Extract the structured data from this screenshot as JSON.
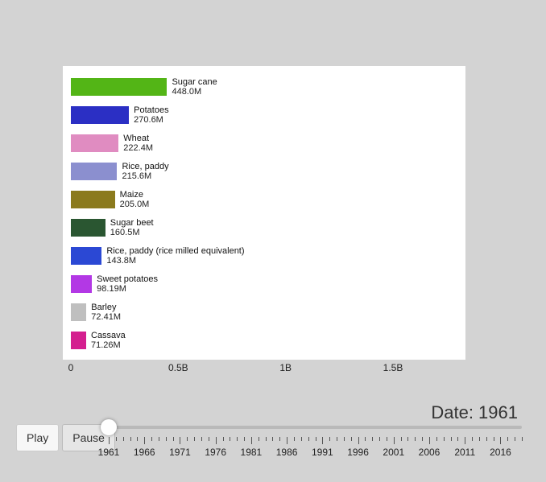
{
  "chart_data": {
    "type": "bar",
    "orientation": "horizontal",
    "categories": [
      "Sugar cane",
      "Potatoes",
      "Wheat",
      "Rice, paddy",
      "Maize",
      "Sugar beet",
      "Rice, paddy (rice milled equivalent)",
      "Sweet potatoes",
      "Barley",
      "Cassava"
    ],
    "values": [
      448000000,
      270600000,
      222400000,
      215600000,
      205000000,
      160500000,
      143800000,
      98190000,
      72410000,
      71260000
    ],
    "value_labels": [
      "448.0M",
      "270.6M",
      "222.4M",
      "215.6M",
      "205.0M",
      "160.5M",
      "143.8M",
      "98.19M",
      "72.41M",
      "71.26M"
    ],
    "colors": [
      "#53b516",
      "#2b2fc4",
      "#e08cc1",
      "#8b8fcf",
      "#8b7a1d",
      "#2a5631",
      "#2b48d4",
      "#b338e5",
      "#bfbfbf",
      "#d41f8f"
    ],
    "xlabel": "",
    "ylabel": "",
    "xlim": [
      0,
      1800000000
    ],
    "x_ticks": [
      0,
      500000000,
      1000000000,
      1500000000
    ],
    "x_tick_labels": [
      "0",
      "0.5B",
      "1B",
      "1.5B"
    ],
    "date_label_prefix": "Date: ",
    "current_date": "1961"
  },
  "controls": {
    "play_label": "Play",
    "pause_label": "Pause"
  },
  "timeline": {
    "start": 1961,
    "end": 2019,
    "current": 1961,
    "major_years": [
      1961,
      1966,
      1971,
      1976,
      1981,
      1986,
      1991,
      1996,
      2001,
      2006,
      2011,
      2016
    ]
  }
}
